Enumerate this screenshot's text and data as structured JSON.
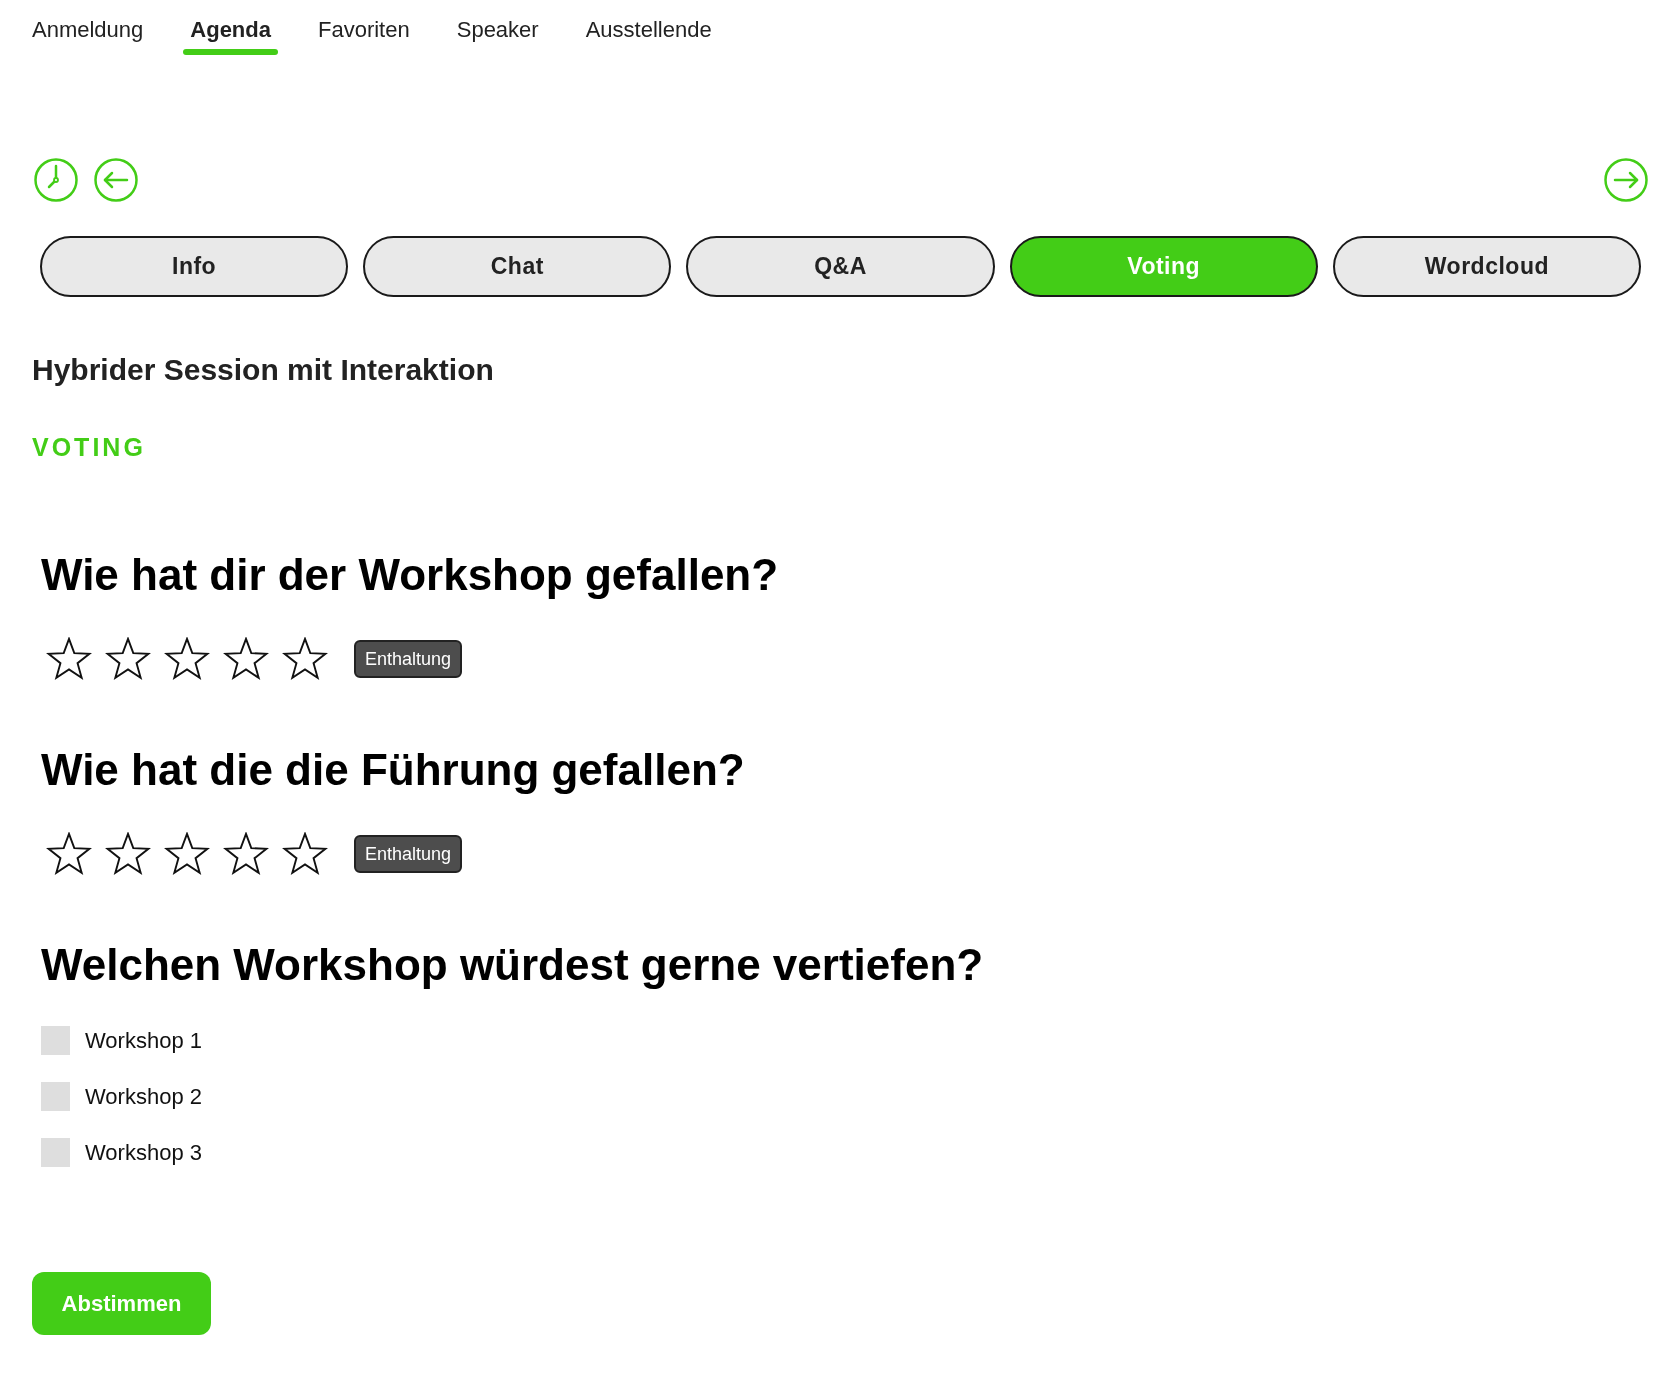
{
  "top_nav": [
    {
      "label": "Anmeldung",
      "selected": false
    },
    {
      "label": "Agenda",
      "selected": true
    },
    {
      "label": "Favoriten",
      "selected": false
    },
    {
      "label": "Speaker",
      "selected": false
    },
    {
      "label": "Ausstellende",
      "selected": false
    }
  ],
  "session_tabs": [
    {
      "label": "Info",
      "selected": false
    },
    {
      "label": "Chat",
      "selected": false
    },
    {
      "label": "Q&A",
      "selected": false
    },
    {
      "label": "Voting",
      "selected": true
    },
    {
      "label": "Wordcloud",
      "selected": false
    }
  ],
  "session_title": "Hybrider Session mit Interaktion",
  "section_label": "VOTING",
  "questions": [
    {
      "kind": "rating",
      "title": "Wie hat dir der Workshop gefallen?",
      "stars": 0,
      "abstain_label": "Enthaltung"
    },
    {
      "kind": "rating",
      "title": "Wie hat die die Führung gefallen?",
      "stars": 0,
      "abstain_label": "Enthaltung"
    },
    {
      "kind": "choice",
      "title": "Welchen Workshop würdest gerne vertiefen?",
      "options": [
        {
          "label": "Workshop 1",
          "checked": false
        },
        {
          "label": "Workshop 2",
          "checked": false
        },
        {
          "label": "Workshop 3",
          "checked": false
        }
      ]
    }
  ],
  "submit_button": "Abstimmen"
}
